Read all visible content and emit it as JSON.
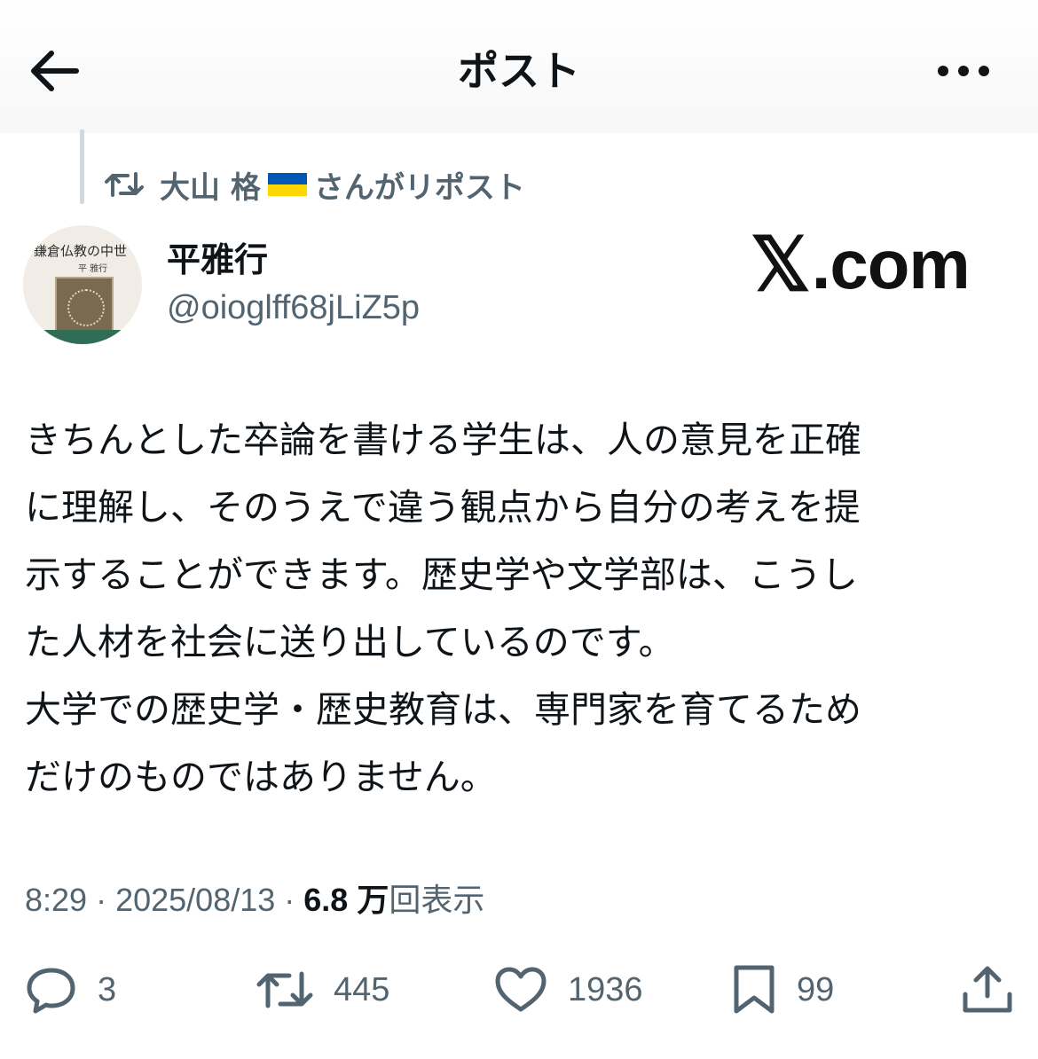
{
  "header": {
    "title": "ポスト",
    "back_icon": "arrow-left-icon",
    "more_icon": "ellipsis-icon"
  },
  "repost": {
    "user": "大山 格",
    "flag": "ukraine-flag",
    "suffix": "さんがリポスト"
  },
  "author": {
    "name": "平雅行",
    "handle": "@oioglff68jLiZ5p",
    "avatar": {
      "book_title": "鎌倉仏教の中世",
      "book_author": "平 雅行"
    }
  },
  "watermark": {
    "x": "𝕏",
    "domain": ".com"
  },
  "post": {
    "lines": [
      "きちんとした卒論を書ける学生は、人の意見を正確",
      "に理解し、そのうえで違う観点から自分の考えを提",
      "示することができます。歴史学や文学部は、こうし",
      "た人材を社会に送り出しているのです。",
      "大学での歴史学・歴史教育は、専門家を育てるため",
      "だけのものではありません。"
    ]
  },
  "meta": {
    "time": "8:29",
    "date": "2025/08/13",
    "views": "6.8 万",
    "views_label": "回表示"
  },
  "actions": {
    "replies": "3",
    "reposts": "445",
    "likes": "1936",
    "bookmarks": "99"
  },
  "colors": {
    "text": "#0f1419",
    "secondary": "#536471",
    "flag_blue": "#0057b7",
    "flag_yellow": "#ffd700"
  }
}
